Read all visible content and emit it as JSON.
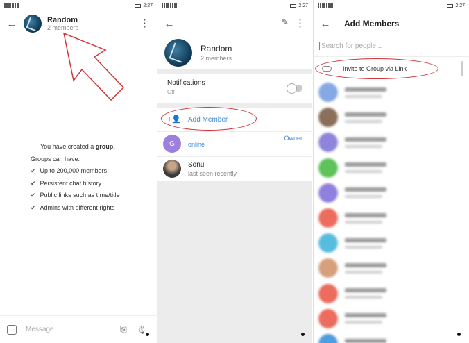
{
  "status_bar": {
    "time": "2:27"
  },
  "screen1": {
    "chat_title": "Random",
    "chat_subtitle": "2 members",
    "info_lines": {
      "created_prefix": "You have created a ",
      "created_bold": "group.",
      "can_have": "Groups can have:",
      "features": [
        "Up to 200,000 members",
        "Persistent chat history",
        "Public links such as t.me/title",
        "Admins with different rights"
      ]
    },
    "composer_placeholder": "Message"
  },
  "screen2": {
    "group_name": "Random",
    "group_subtitle": "2 members",
    "notifications_label": "Notifications",
    "notifications_value": "Off",
    "add_member_label": "Add Member",
    "members": [
      {
        "initial": "G",
        "name": "",
        "status": "online",
        "role": "Owner",
        "color": "#9d7fe0"
      },
      {
        "initial": "",
        "name": "Sonu",
        "status": "last seen recently",
        "role": "",
        "color": "#5a5a5a"
      }
    ]
  },
  "screen3": {
    "title": "Add Members",
    "search_placeholder": "Search for people...",
    "invite_label": "Invite to Group via Link",
    "contact_colors": [
      "#86a9e6",
      "#8a6f5a",
      "#8e84db",
      "#5ec35a",
      "#8f80df",
      "#ec6c5e",
      "#56bde0",
      "#d7a07b",
      "#ec6c5e",
      "#ec6c5e",
      "#4e9de0"
    ]
  },
  "colors": {
    "accent": "#3f8bd3",
    "annotation": "#d0353b"
  }
}
